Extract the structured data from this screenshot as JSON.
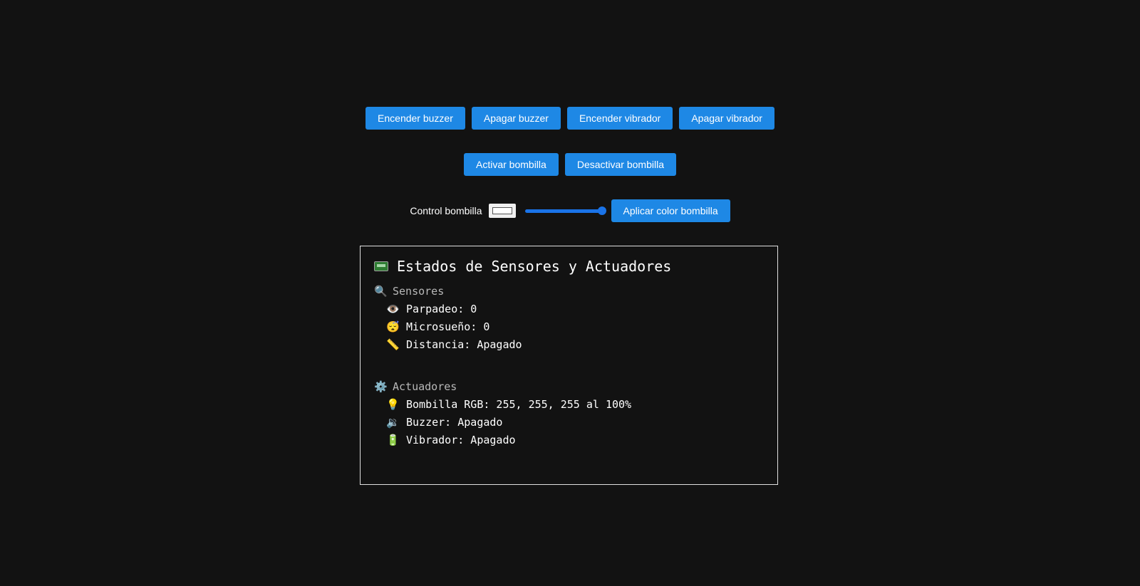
{
  "buttons_row1": [
    "Encender buzzer",
    "Apagar buzzer",
    "Encender vibrador",
    "Apagar vibrador"
  ],
  "buttons_row2": [
    "Activar bombilla",
    "Desactivar bombilla"
  ],
  "control": {
    "label": "Control bombilla",
    "color_value": "#ffffff",
    "slider_level": 1.0,
    "apply_label": "Aplicar color bombilla"
  },
  "panel": {
    "title": "Estados de Sensores y Actuadores",
    "sensores": {
      "heading": "Sensores",
      "items": [
        {
          "icon": "👁️",
          "icon_name": "eye-icon",
          "text": "Parpadeo: 0"
        },
        {
          "icon": "😴",
          "icon_name": "sleeping-face-icon",
          "text": "Microsueño: 0"
        },
        {
          "icon": "📏",
          "icon_name": "ruler-icon",
          "text": "Distancia: Apagado"
        }
      ]
    },
    "actuadores": {
      "heading": "Actuadores",
      "items": [
        {
          "icon": "💡",
          "icon_name": "light-bulb-icon",
          "text": "Bombilla RGB: 255, 255, 255 al 100%"
        },
        {
          "icon": "🔉",
          "icon_name": "speaker-icon",
          "text": "Buzzer: Apagado"
        },
        {
          "icon": "🔋",
          "icon_name": "battery-icon",
          "text": "Vibrador: Apagado"
        }
      ]
    }
  },
  "colors": {
    "background": "#121212",
    "button": "#1e88e5",
    "slider": "#1a73e8",
    "panel_border": "#e0e0e0"
  }
}
